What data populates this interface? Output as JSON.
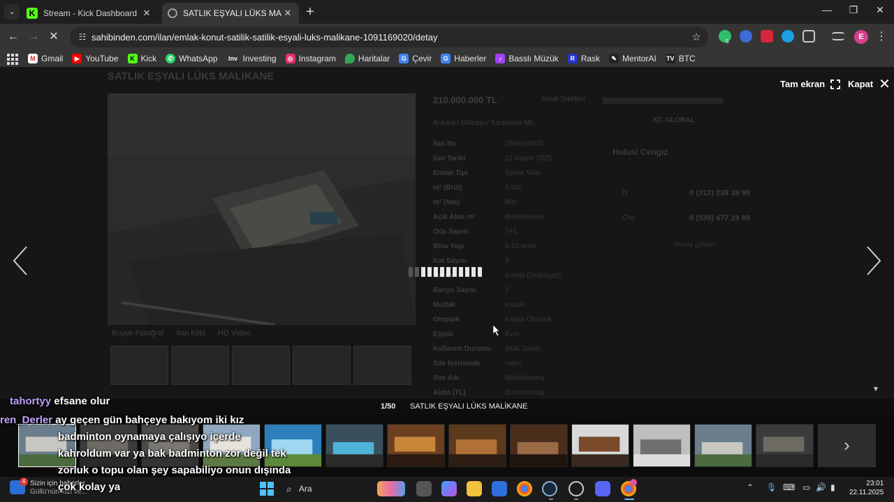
{
  "browser": {
    "tabs": [
      {
        "title": "Stream - Kick Dashboard",
        "active": false
      },
      {
        "title": "SATLIK EŞYALI LÜKS MALİKANE",
        "active": true
      }
    ],
    "url": "sahibinden.com/ilan/emlak-konut-satilik-satilik-esyali-luks-malikane-1091169020/detay",
    "profile_initial": "E",
    "bookmarks": [
      "Gmail",
      "YouTube",
      "Kick",
      "WhatsApp",
      "Investing",
      "Instagram",
      "Haritalar",
      "Çevir",
      "Haberler",
      "Basslı Müzük",
      "Rask",
      "MentorAI",
      "BTC"
    ],
    "extension_badge": "5"
  },
  "page": {
    "title": "SATLIK EŞYALI LÜKS MALİKANE",
    "price": "210.000.000 TL",
    "price_note": "Kredi Teklifleri",
    "breadcrumb": "Ankara / Gölbaşı / Karşıyaka Mh.",
    "photo_links": [
      "Büyük Fotoğraf",
      "İlan Klibi",
      "HD Video"
    ],
    "specs": [
      {
        "k": "İlan No",
        "v": "1091169020"
      },
      {
        "k": "İlan Tarihi",
        "v": "22 Kasım 2025"
      },
      {
        "k": "Emlak Tipi",
        "v": "Satılık Villa"
      },
      {
        "k": "m² (Brüt)",
        "v": "1.940"
      },
      {
        "k": "m² (Net)",
        "v": "800"
      },
      {
        "k": "Açık Alan m²",
        "v": "Belirtilmemiş"
      },
      {
        "k": "Oda Sayısı",
        "v": "7+1"
      },
      {
        "k": "Bina Yaşı",
        "v": "6-10 arası"
      },
      {
        "k": "Kat Sayısı",
        "v": "3"
      },
      {
        "k": "Isıtma",
        "v": "Kombi (Doğalgaz)"
      },
      {
        "k": "Banyo Sayısı",
        "v": "3"
      },
      {
        "k": "Mutfak",
        "v": "Kapalı"
      },
      {
        "k": "Otopark",
        "v": "Kapalı Otopark"
      },
      {
        "k": "Eşyalı",
        "v": "Evet"
      },
      {
        "k": "Kullanım Durumu",
        "v": "Mülk Sahibi"
      },
      {
        "k": "Site İçerisinde",
        "v": "Hayır"
      },
      {
        "k": "Site Adı",
        "v": "Belirtilmemiş"
      },
      {
        "k": "Aidat (TL)",
        "v": "Belirtilmemiş"
      }
    ],
    "seller": {
      "agency": "KC GLOBAL",
      "name": "Hulusi Cengiz",
      "phones": [
        {
          "label": "İş",
          "number": "0 (312) 238 39 99"
        },
        {
          "label": "Cep",
          "number": "0 (539) 477 19 88"
        }
      ],
      "message": "Mesaj gönder"
    }
  },
  "lightbox": {
    "fullscreen_label": "Tam ekran",
    "close_label": "Kapat",
    "counter": "1/50",
    "caption": "SATLIK EŞYALI LÜKS MALİKANE",
    "thumbnail_count": 13
  },
  "chat": [
    {
      "user": "tahortyy",
      "text": "efsane olur"
    },
    {
      "user": "ren_Derler",
      "text": "ay geçen gün bahçeye bakıyom iki kız"
    },
    {
      "user": "",
      "text": "badminton oynamaya çalışıyo içerde"
    },
    {
      "user": "",
      "text": "kahroldum var ya bak badminton zor değil tek"
    },
    {
      "user": "",
      "text": "zorluk o topu olan şey sapabiliyo onun dışında"
    },
    {
      "user": "",
      "text": "çok kolay ya"
    }
  ],
  "taskbar": {
    "news_badge": "4",
    "news_title": "Sizin için haberler",
    "news_sub": "Güllü'nün kızı ve...",
    "search_label": "Ara",
    "time": "23:01",
    "date": "22.11.2025"
  }
}
